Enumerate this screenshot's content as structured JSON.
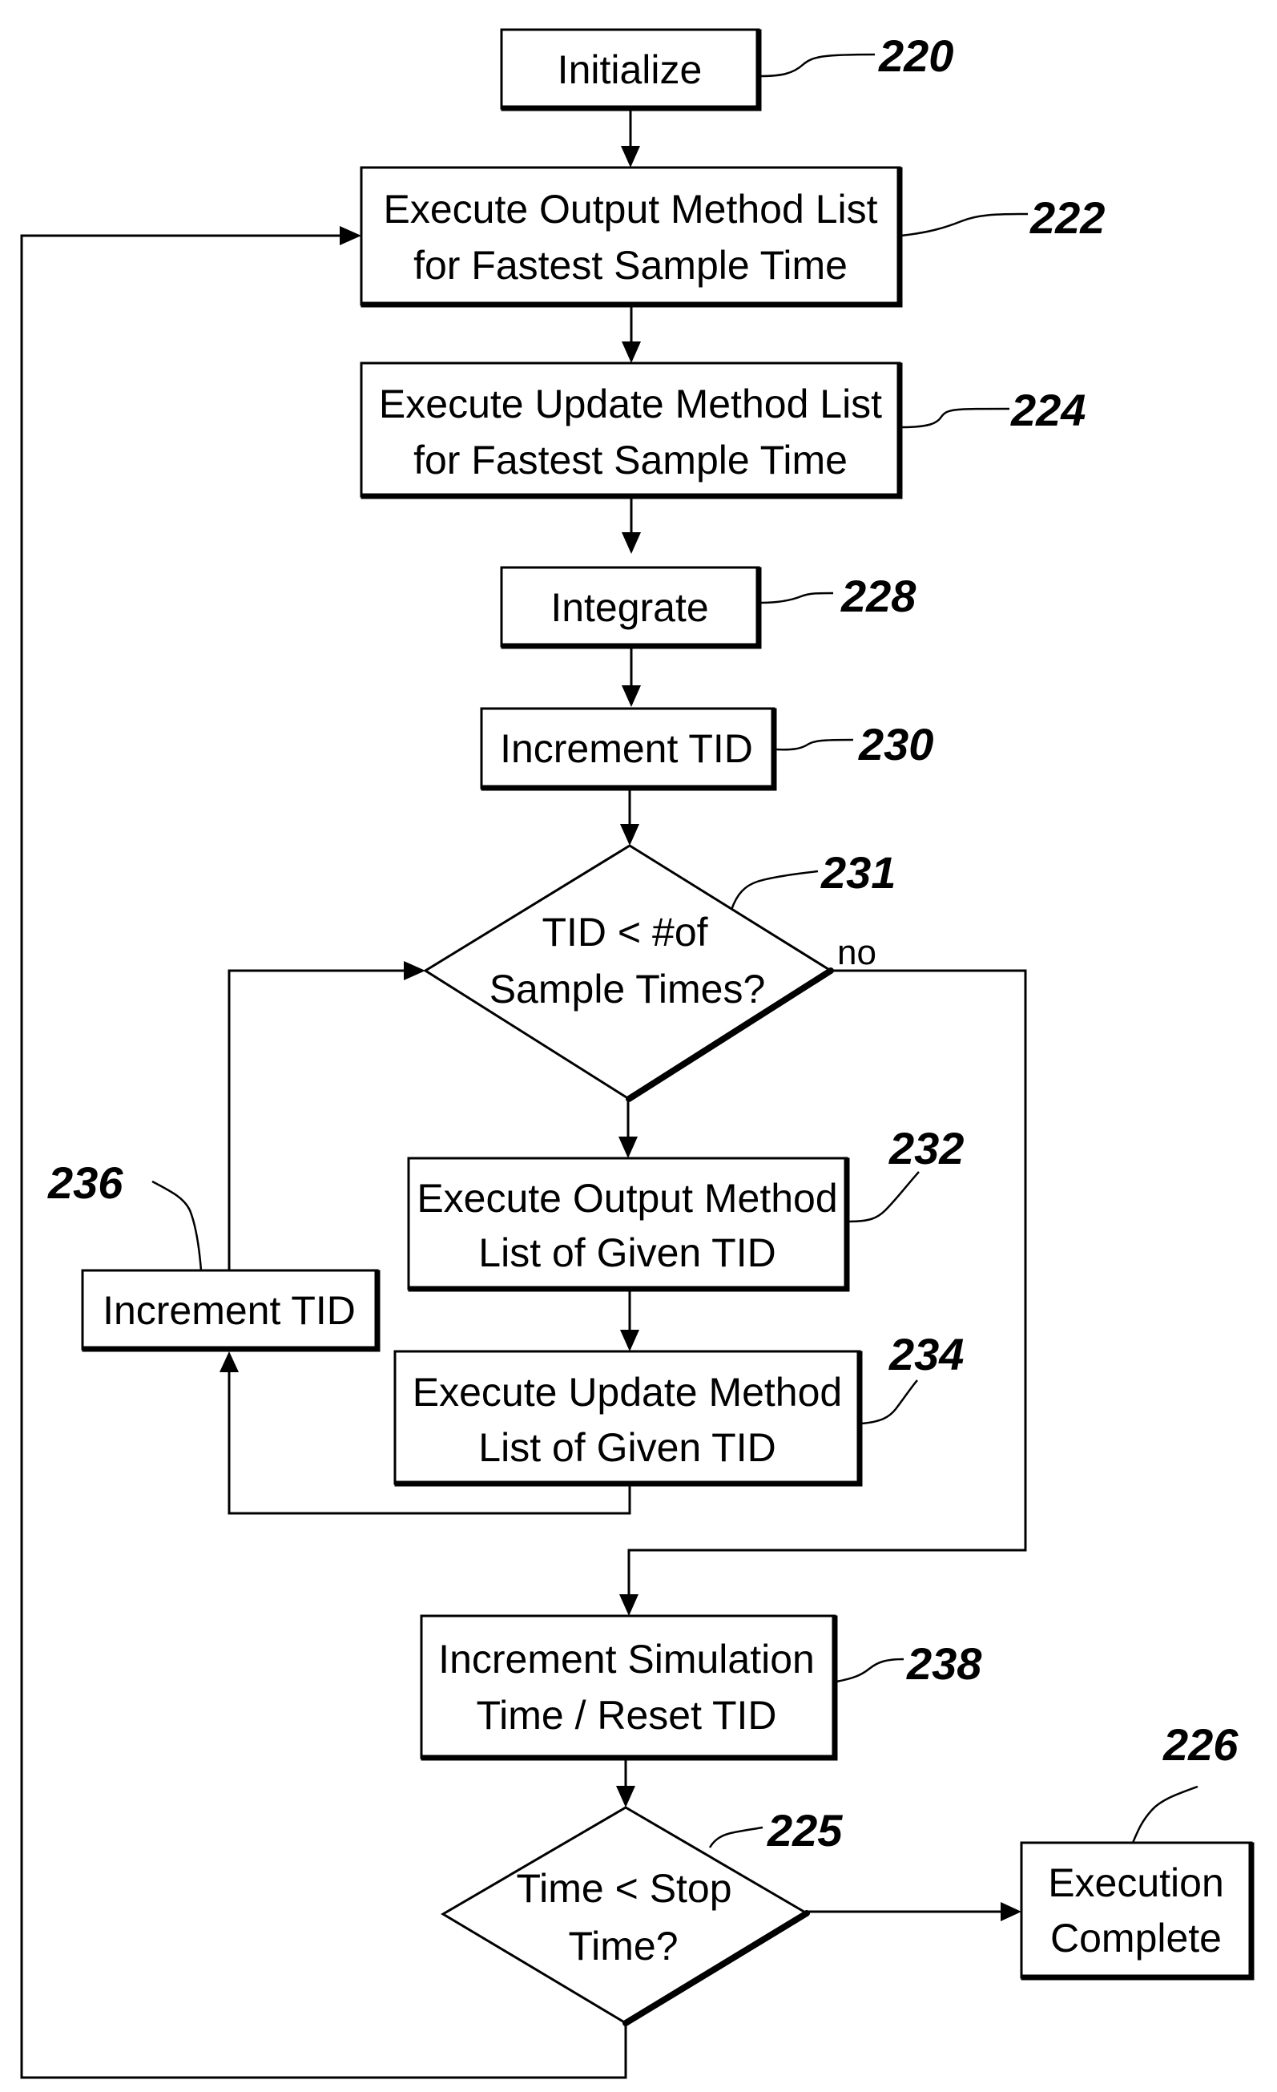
{
  "figure": {
    "nodes": [
      {
        "id": "initialize",
        "ref": "220",
        "type": "process",
        "lines": [
          "Initialize"
        ]
      },
      {
        "id": "exec-output-fastest",
        "ref": "222",
        "type": "process",
        "lines": [
          "Execute Output Method List",
          "for Fastest Sample Time"
        ]
      },
      {
        "id": "exec-update-fastest",
        "ref": "224",
        "type": "process",
        "lines": [
          "Execute Update Method List",
          "for Fastest Sample Time"
        ]
      },
      {
        "id": "integrate",
        "ref": "228",
        "type": "process",
        "lines": [
          "Integrate"
        ]
      },
      {
        "id": "increment-tid",
        "ref": "230",
        "type": "process",
        "lines": [
          "Increment TID"
        ]
      },
      {
        "id": "tid-decision",
        "ref": "231",
        "type": "decision",
        "lines": [
          "TID < #of",
          "Sample Times?"
        ]
      },
      {
        "id": "exec-output-given",
        "ref": "232",
        "type": "process",
        "lines": [
          "Execute Output Method",
          "List of Given TID"
        ]
      },
      {
        "id": "exec-update-given",
        "ref": "234",
        "type": "process",
        "lines": [
          "Execute Update Method",
          "List of Given TID"
        ]
      },
      {
        "id": "increment-tid-loop",
        "ref": "236",
        "type": "process",
        "lines": [
          "Increment TID"
        ]
      },
      {
        "id": "increment-sim-time",
        "ref": "238",
        "type": "process",
        "lines": [
          "Increment Simulation",
          "Time / Reset TID"
        ]
      },
      {
        "id": "time-decision",
        "ref": "225",
        "type": "decision",
        "lines": [
          "Time < Stop",
          "Time?"
        ]
      },
      {
        "id": "execution-complete",
        "ref": "226",
        "type": "terminal",
        "lines": [
          "Execution",
          "Complete"
        ]
      }
    ],
    "edges": [
      {
        "from": "initialize",
        "to": "exec-output-fastest",
        "label": ""
      },
      {
        "from": "exec-output-fastest",
        "to": "exec-update-fastest",
        "label": ""
      },
      {
        "from": "exec-update-fastest",
        "to": "integrate",
        "label": ""
      },
      {
        "from": "integrate",
        "to": "increment-tid",
        "label": ""
      },
      {
        "from": "increment-tid",
        "to": "tid-decision",
        "label": ""
      },
      {
        "from": "tid-decision",
        "to": "exec-output-given",
        "label": ""
      },
      {
        "from": "exec-output-given",
        "to": "exec-update-given",
        "label": ""
      },
      {
        "from": "exec-update-given",
        "to": "increment-tid-loop",
        "label": ""
      },
      {
        "from": "increment-tid-loop",
        "to": "tid-decision",
        "label": ""
      },
      {
        "from": "tid-decision",
        "to": "increment-sim-time",
        "label": "no"
      },
      {
        "from": "increment-sim-time",
        "to": "time-decision",
        "label": ""
      },
      {
        "from": "time-decision",
        "to": "execution-complete",
        "label": ""
      },
      {
        "from": "time-decision",
        "to": "exec-output-fastest",
        "label": ""
      }
    ],
    "no_label": "no"
  }
}
